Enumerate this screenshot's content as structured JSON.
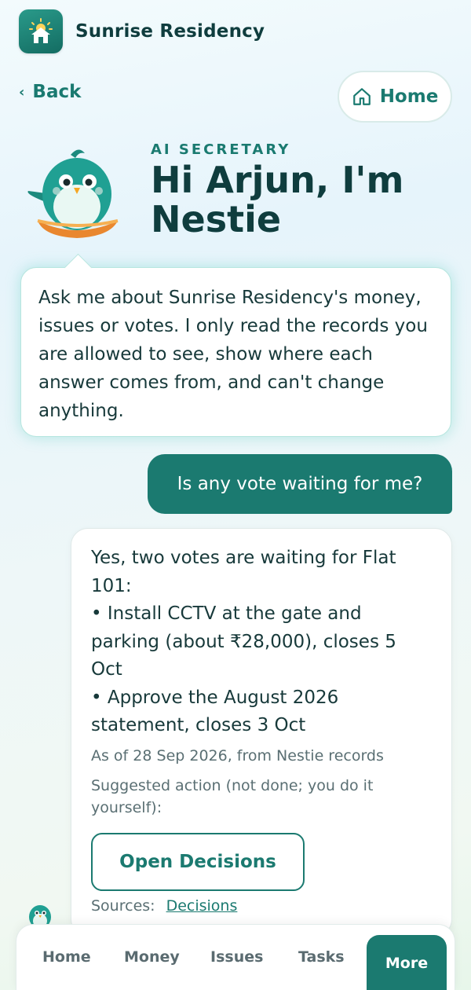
{
  "header": {
    "app_name": "Sunrise Residency",
    "logo_icon": "house-sun-icon"
  },
  "nav_top": {
    "back_label": "Back",
    "home_label": "Home"
  },
  "hero": {
    "kicker": "AI SECRETARY",
    "title": "Hi Arjun, I'm Nestie",
    "mascot_icon": "bird-mascot-icon"
  },
  "intro": {
    "text": "Ask me about Sunrise Residency's money, issues or votes. I only read the records you are allowed to see, show where each answer comes from, and can't change anything."
  },
  "conversation": {
    "user_message": "Is any vote waiting for me?",
    "reply": {
      "lines": [
        "Yes, two votes are waiting for Flat 101:",
        "• Install CCTV at the gate and parking (about ₹28,000), closes 5 Oct",
        "• Approve the August 2026 statement, closes 3 Oct"
      ],
      "meta": "As of 28 Sep 2026, from Nestie records",
      "suggested": "Suggested action (not done; you do it yourself):",
      "action_label": "Open Decisions",
      "sources_label": "Sources:",
      "source_link": "Decisions"
    }
  },
  "bottom_nav": {
    "tabs": [
      "Home",
      "Money",
      "Issues",
      "Tasks"
    ],
    "active": "More"
  },
  "colors": {
    "accent": "#1b7a70",
    "title": "#0f3d3e",
    "bubble_glow": "#b7e6df"
  }
}
